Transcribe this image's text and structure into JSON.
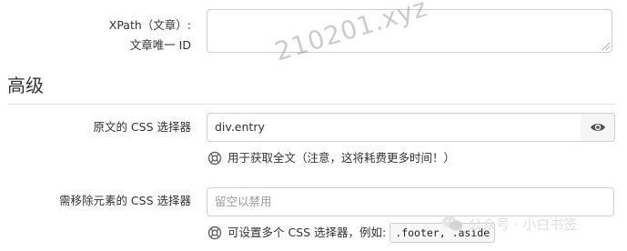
{
  "fields": {
    "xpath": {
      "label_line1": "XPath（文章）:",
      "label_line2": "文章唯一 ID",
      "value": ""
    },
    "section_title": "高级",
    "content_selector": {
      "label": "原文的 CSS 选择器",
      "value": "div.entry",
      "help": "用于获取全文（注意，这将耗费更多时间！）",
      "toggle_icon": "eye-icon"
    },
    "remove_selector": {
      "label": "需移除元素的 CSS 选择器",
      "placeholder": "留空以禁用",
      "help": "可设置多个 CSS 选择器，例如:",
      "example": ".footer, .aside"
    }
  },
  "watermark": "210201.xyz",
  "wechat_overlay": "公众号 · 小白书签"
}
